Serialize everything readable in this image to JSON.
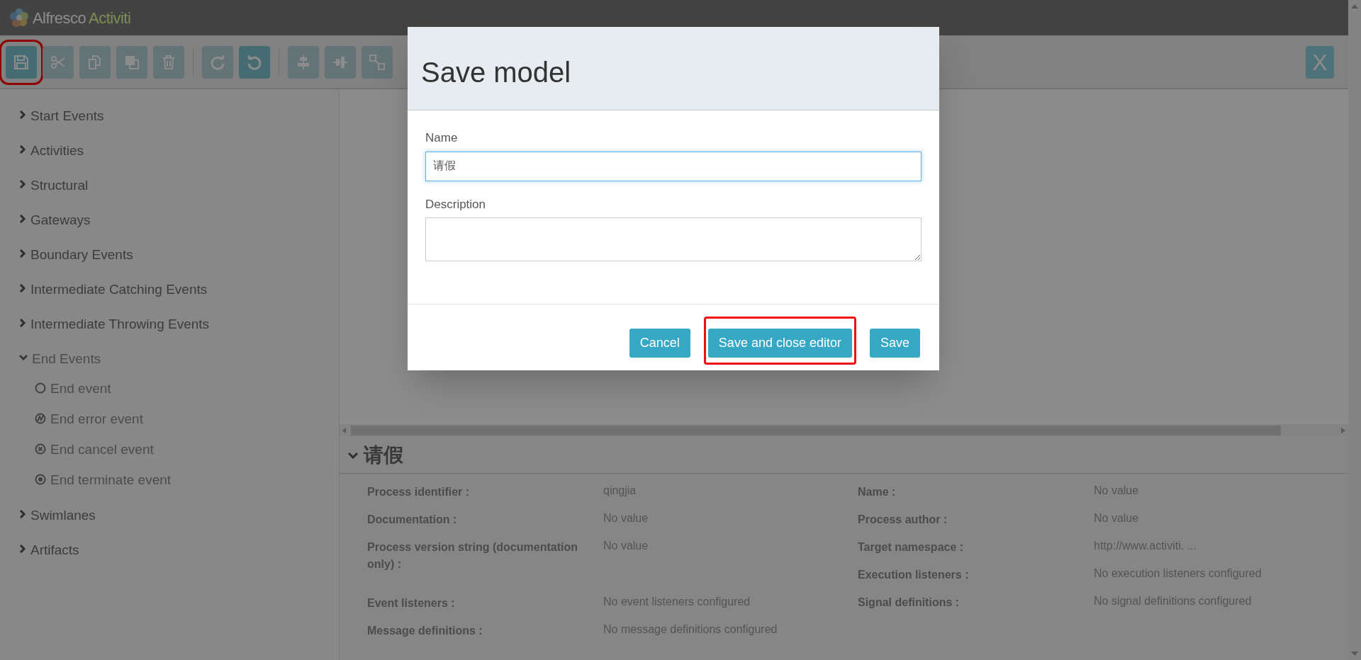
{
  "header": {
    "brand": "Alfresco",
    "product": "Activiti"
  },
  "toolbar": {
    "groups": [
      [
        {
          "kind": "save",
          "disabled": false,
          "highlighted": true
        },
        {
          "kind": "cut",
          "disabled": true,
          "highlighted": false
        },
        {
          "kind": "copy",
          "disabled": true,
          "highlighted": false
        },
        {
          "kind": "paste",
          "disabled": true,
          "highlighted": false
        },
        {
          "kind": "delete",
          "disabled": true,
          "highlighted": false
        }
      ],
      [
        {
          "kind": "redo",
          "disabled": true,
          "highlighted": false
        },
        {
          "kind": "undo",
          "disabled": false,
          "highlighted": false
        }
      ],
      [
        {
          "kind": "align-horizontal",
          "disabled": true,
          "highlighted": false
        },
        {
          "kind": "align-vertical",
          "disabled": true,
          "highlighted": false
        },
        {
          "kind": "same-size",
          "disabled": true,
          "highlighted": false
        }
      ]
    ],
    "close_button": "X"
  },
  "palette": [
    {
      "label": "Start Events",
      "expanded": false
    },
    {
      "label": "Activities",
      "expanded": false
    },
    {
      "label": "Structural",
      "expanded": false
    },
    {
      "label": "Gateways",
      "expanded": false
    },
    {
      "label": "Boundary Events",
      "expanded": false
    },
    {
      "label": "Intermediate Catching Events",
      "expanded": false
    },
    {
      "label": "Intermediate Throwing Events",
      "expanded": false
    },
    {
      "label": "End Events",
      "expanded": true,
      "children": [
        {
          "label": "End event",
          "kind": "none"
        },
        {
          "label": "End error event",
          "kind": "error"
        },
        {
          "label": "End cancel event",
          "kind": "cancel"
        },
        {
          "label": "End terminate event",
          "kind": "terminate"
        }
      ]
    },
    {
      "label": "Swimlanes",
      "expanded": false
    },
    {
      "label": "Artifacts",
      "expanded": false
    }
  ],
  "properties": {
    "title": "请假",
    "expanded": true,
    "left": [
      {
        "label": "Process identifier :",
        "value": "qingjia"
      },
      {
        "label": "Documentation :",
        "value": "No value"
      },
      {
        "label": "Process version string (documentation only) :",
        "value": "No value"
      },
      {
        "label": "Event listeners :",
        "value": "No event listeners configured"
      },
      {
        "label": "Message definitions :",
        "value": "No message definitions configured"
      }
    ],
    "right": [
      {
        "label": "Name :",
        "value": "No value"
      },
      {
        "label": "Process author :",
        "value": "No value"
      },
      {
        "label": "Target namespace :",
        "value": "http://www.activiti. ..."
      },
      {
        "label": "Execution listeners :",
        "value": "No execution listeners configured"
      },
      {
        "label": "Signal definitions :",
        "value": "No signal definitions configured"
      }
    ]
  },
  "dialog": {
    "title": "Save model",
    "fields": [
      {
        "kind": "input",
        "label": "Name",
        "value": "请假",
        "focused": true
      },
      {
        "kind": "textarea",
        "label": "Description",
        "focused": false
      }
    ],
    "buttons": [
      {
        "label": "Cancel",
        "highlighted": false
      },
      {
        "label": "Save and close editor",
        "highlighted": true
      },
      {
        "label": "Save",
        "highlighted": false
      }
    ]
  }
}
